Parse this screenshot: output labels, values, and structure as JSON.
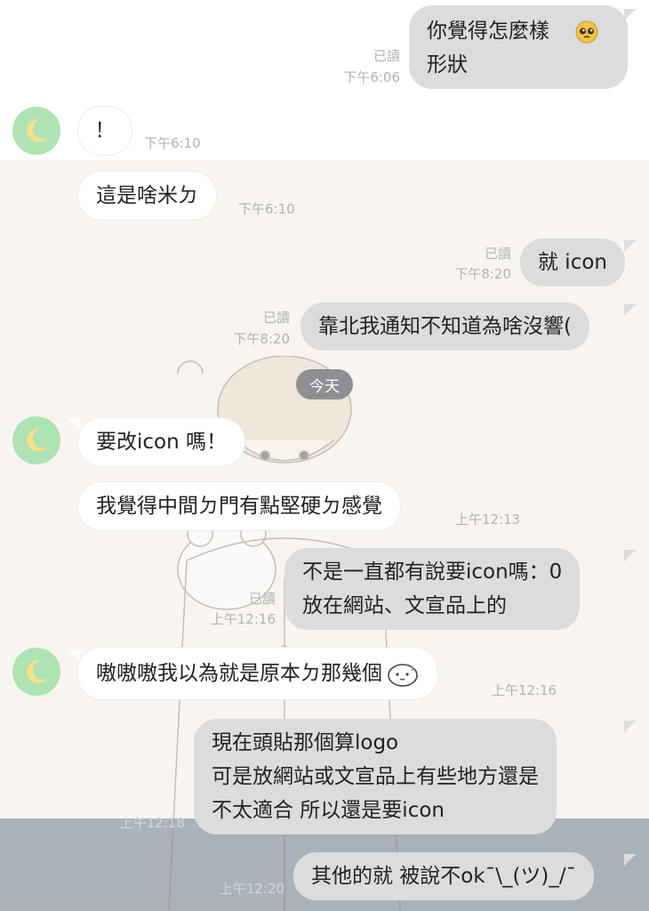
{
  "date_divider": "今天",
  "messages": [
    {
      "id": "m1",
      "side": "out",
      "lines": "你覺得怎麼樣\n形狀",
      "emoji": "pleading-face",
      "read": "已讀",
      "time": "下午6:06"
    },
    {
      "id": "m2",
      "side": "in",
      "text": "！",
      "time": "下午6:10"
    },
    {
      "id": "m3",
      "side": "in",
      "text": "這是啥米ㄉ",
      "time": "下午6:10"
    },
    {
      "id": "m4",
      "side": "out",
      "text": "就 icon",
      "read": "已讀",
      "time": "下午8:20"
    },
    {
      "id": "m5",
      "side": "out",
      "text": "靠北我通知不知道為啥沒響(",
      "read": "已讀",
      "time": "下午8:20"
    },
    {
      "id": "m6",
      "side": "in",
      "text": "要改icon 嗎！"
    },
    {
      "id": "m7",
      "side": "in",
      "text": "我覺得中間ㄉ門有點堅硬ㄉ感覺",
      "time": "上午12:13"
    },
    {
      "id": "m8",
      "side": "out",
      "lines": "不是一直都有說要icon嗎：0\n放在網站、文宣品上的",
      "read": "已讀",
      "time": "上午12:16"
    },
    {
      "id": "m9",
      "side": "in",
      "text": "嗷嗷嗷我以為就是原本ㄉ那幾個",
      "emoji": "sweat-blob-sticker",
      "time": "上午12:16"
    },
    {
      "id": "m10",
      "side": "out",
      "lines": "現在頭貼那個算logo\n可是放網站或文宣品上有些地方還是\n不太適合 所以還是要icon",
      "time": "上午12:18"
    },
    {
      "id": "m11",
      "side": "out",
      "text": "其他的就 被說不ok¯\\_(ツ)_/¯",
      "time": "上午12:20"
    }
  ],
  "avatar_icon": "crescent-moon-icon",
  "colors": {
    "bubble_out": "#dcdcdc",
    "bubble_in": "#ffffff",
    "avatar_bg": "#aee3b4",
    "moon": "#f7e08a",
    "meta_text": "#b2b2b2",
    "chip_bg": "#8d8f92"
  }
}
